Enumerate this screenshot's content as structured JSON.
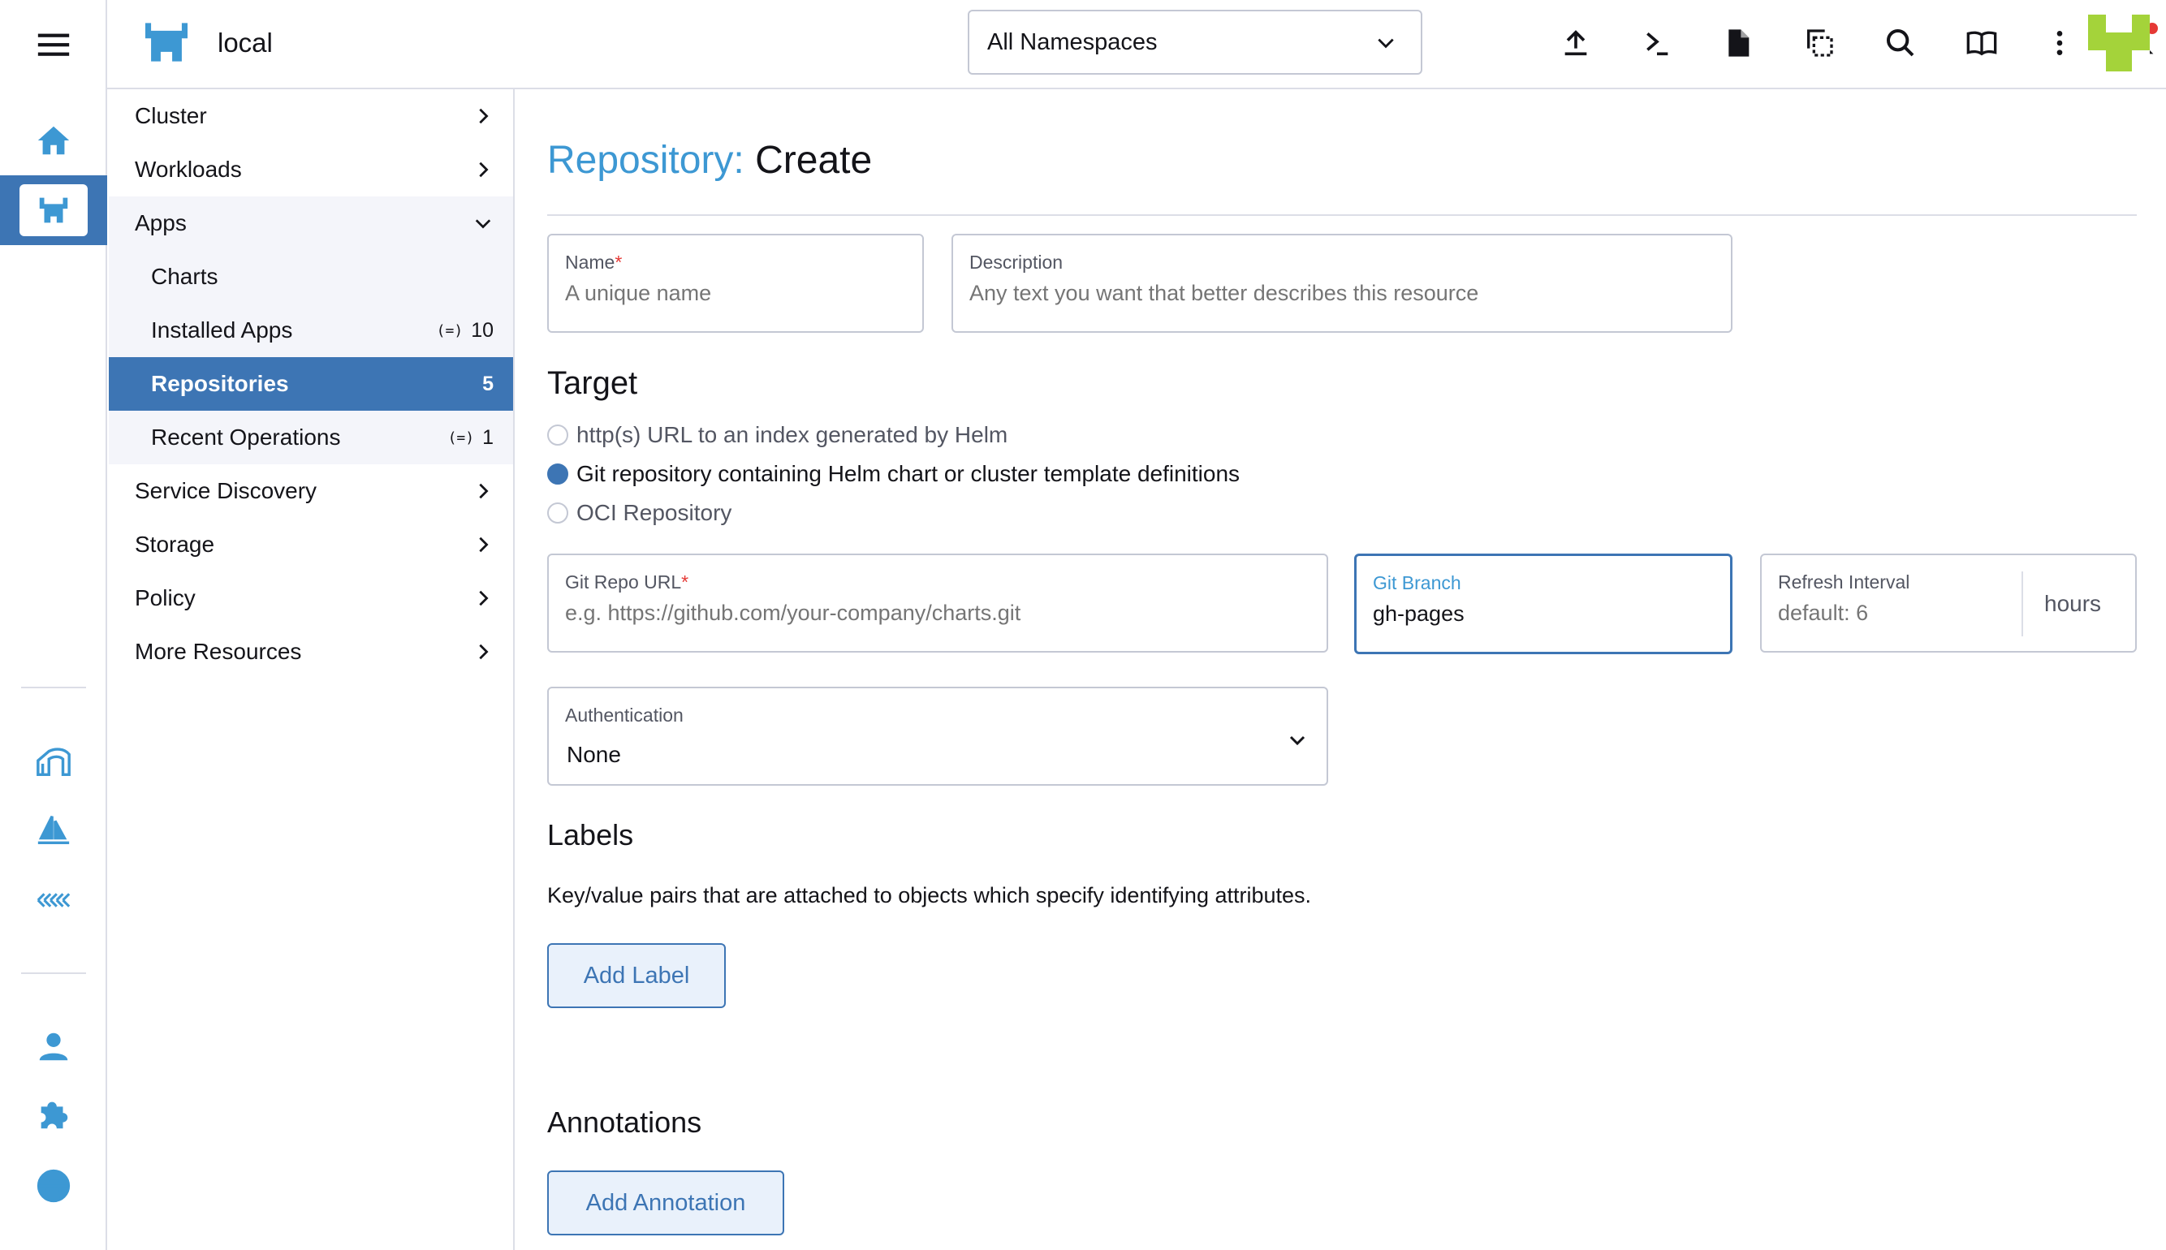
{
  "header": {
    "cluster_name": "local",
    "namespace_select": "All Namespaces",
    "icons": [
      "upload-icon",
      "terminal-icon",
      "file-icon",
      "copy-icon",
      "search-icon",
      "book-icon",
      "more-icon",
      "bell-icon"
    ]
  },
  "rail": {
    "icons": [
      "menu-icon",
      "home-icon",
      "cluster-icon",
      "fleet-icon",
      "sail-icon",
      "extensions-grid-icon",
      "user-icon",
      "puzzle-icon",
      "globe-icon"
    ]
  },
  "sidenav": {
    "items": [
      {
        "label": "Cluster"
      },
      {
        "label": "Workloads"
      },
      {
        "label": "Apps"
      },
      {
        "label": "Charts"
      },
      {
        "label": "Installed Apps",
        "count": "10"
      },
      {
        "label": "Repositories",
        "count": "5"
      },
      {
        "label": "Recent Operations",
        "count": "1"
      },
      {
        "label": "Service Discovery"
      },
      {
        "label": "Storage"
      },
      {
        "label": "Policy"
      },
      {
        "label": "More Resources"
      }
    ],
    "namespace_tag": "(=)"
  },
  "main": {
    "title_prefix": "Repository:",
    "title_action": "Create",
    "name_field": {
      "label": "Name",
      "required_mark": "*",
      "placeholder": "A unique name"
    },
    "description_field": {
      "label": "Description",
      "placeholder": "Any text you want that better describes this resource"
    },
    "target": {
      "title": "Target",
      "options": [
        {
          "label": "http(s) URL to an index generated by Helm",
          "checked": false
        },
        {
          "label": "Git repository containing Helm chart or cluster template definitions",
          "checked": true
        },
        {
          "label": "OCI Repository",
          "checked": false
        }
      ]
    },
    "git_repo_url": {
      "label": "Git Repo URL",
      "required_mark": "*",
      "placeholder": "e.g. https://github.com/your-company/charts.git"
    },
    "git_branch": {
      "label": "Git Branch",
      "value": "gh-pages"
    },
    "refresh_interval": {
      "label": "Refresh Interval",
      "placeholder": "default: 6",
      "unit": "hours"
    },
    "authentication": {
      "label": "Authentication",
      "value": "None"
    },
    "labels": {
      "title": "Labels",
      "description": "Key/value pairs that are attached to objects which specify identifying attributes.",
      "add_button": "Add Label"
    },
    "annotations": {
      "title": "Annotations",
      "add_button": "Add Annotation"
    }
  },
  "colors": {
    "accent": "#3d75b4",
    "accent_light": "#3d98d3",
    "required": "#e53935",
    "avatar": "#a4d33a"
  }
}
